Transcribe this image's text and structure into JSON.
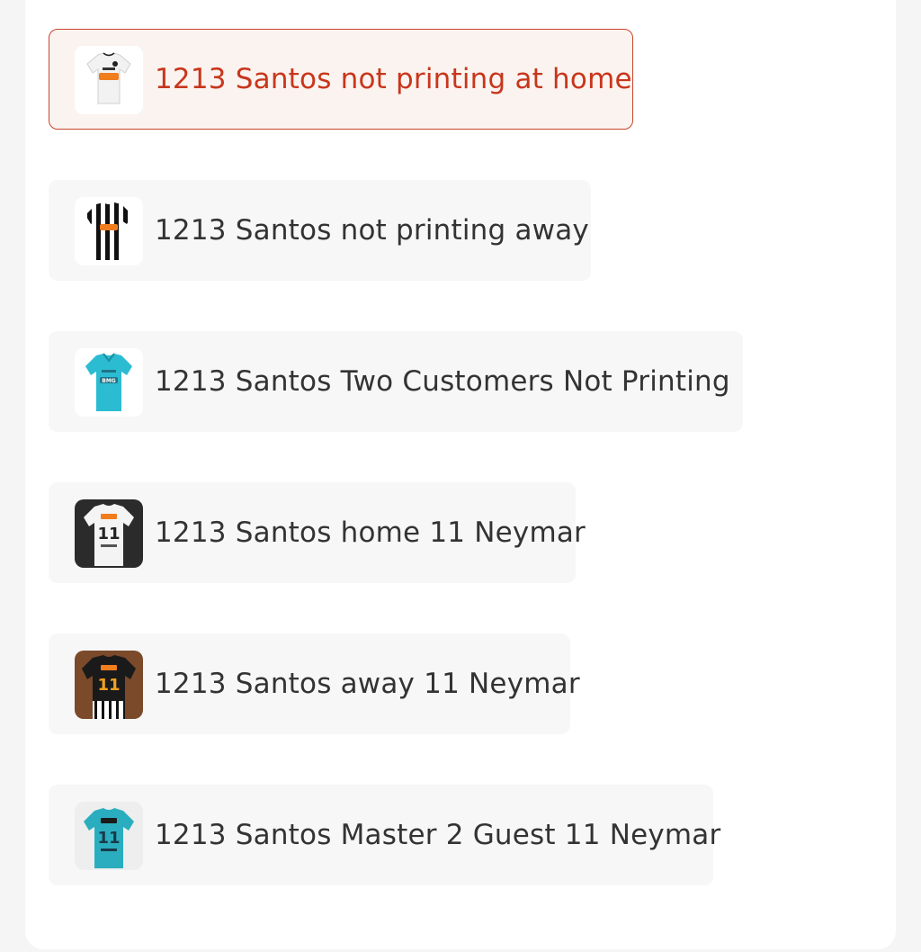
{
  "colors": {
    "accent": "#c8361c",
    "selected_background": "#fbf3ef",
    "option_background": "#f7f7f7",
    "text": "#333333"
  },
  "variants": {
    "selected_index": 0,
    "options": [
      {
        "label": "1213 Santos not printing at home",
        "thumbnail": "santos-home-white-jersey-thumbnail"
      },
      {
        "label": "1213 Santos not printing away",
        "thumbnail": "santos-away-striped-jersey-thumbnail"
      },
      {
        "label": "1213 Santos Two Customers Not Printing",
        "thumbnail": "santos-third-blue-jersey-thumbnail"
      },
      {
        "label": "1213 Santos home 11 Neymar",
        "thumbnail": "santos-home-neymar-jersey-thumbnail"
      },
      {
        "label": "1213 Santos away 11 Neymar",
        "thumbnail": "santos-away-neymar-jersey-thumbnail"
      },
      {
        "label": "1213 Santos Master 2 Guest 11 Neymar",
        "thumbnail": "santos-third-neymar-jersey-thumbnail"
      }
    ]
  }
}
